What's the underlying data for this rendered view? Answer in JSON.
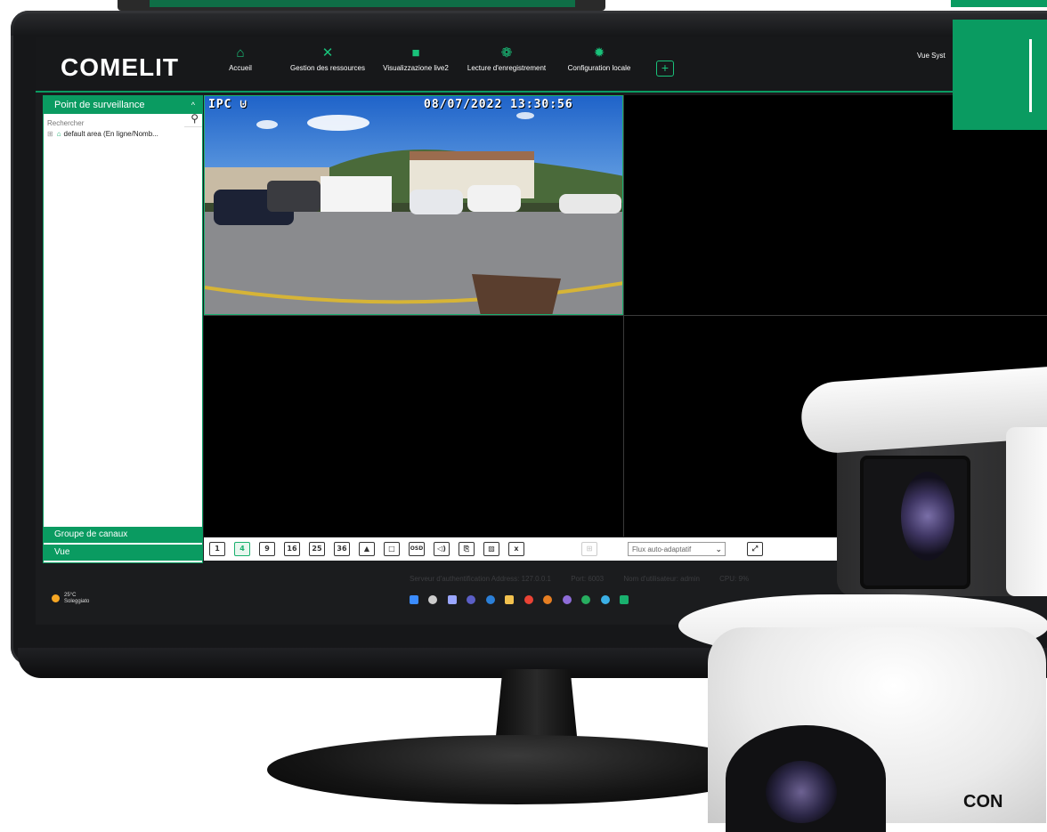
{
  "brand": {
    "logo_text": "COMELIT",
    "accent_color": "#0a9b61"
  },
  "nav": {
    "items": [
      {
        "label": "Accueil",
        "icon": "home-icon"
      },
      {
        "label": "Gestion des ressources",
        "icon": "tools-icon"
      },
      {
        "label": "Visualizzazione live2",
        "icon": "video-camera-icon"
      },
      {
        "label": "Lecture d'enregistrement",
        "icon": "playback-icon"
      },
      {
        "label": "Configuration locale",
        "icon": "gear-icon"
      }
    ],
    "add_icon": "plus-square-icon",
    "right_label": "Vue Syst"
  },
  "left_panel": {
    "header": "Point de surveillance",
    "search_placeholder": "Rechercher",
    "tree_item": "default area (En ligne/Nomb...",
    "group_channels": "Groupe de canaux",
    "view": "Vue"
  },
  "video": {
    "channel_label": "IPC",
    "channel_icon": "signal-icon",
    "timestamp": "08/07/2022 13:30:56"
  },
  "toolbar": {
    "buttons": [
      {
        "label": "1",
        "name": "layout-1-button"
      },
      {
        "label": "4",
        "name": "layout-4-button",
        "active": true
      },
      {
        "label": "9",
        "name": "layout-9-button"
      },
      {
        "label": "16",
        "name": "layout-16-button"
      },
      {
        "label": "25",
        "name": "layout-25-button"
      },
      {
        "label": "36",
        "name": "layout-36-button"
      },
      {
        "label": "▲",
        "name": "custom-layout-button"
      },
      {
        "label": "□",
        "name": "full-screen-button"
      },
      {
        "label": "OSD",
        "name": "osd-toggle-button"
      },
      {
        "label": "◁)",
        "name": "audio-button"
      },
      {
        "label": "⎘",
        "name": "snapshot-button"
      },
      {
        "label": "▨",
        "name": "close-all-button"
      },
      {
        "label": "x",
        "name": "stop-all-button"
      },
      {
        "label": "⊞",
        "name": "grid-button"
      }
    ],
    "stream_select": "Flux auto-adaptatif",
    "maximize_icon": "expand-icon"
  },
  "status_bar": {
    "server": "Serveur d'authentification Address: 127.0.0.1",
    "port": "Port: 6003",
    "user": "Nom d'utilisateur: admin",
    "cpu": "CPU: 9%"
  },
  "taskbar": {
    "weather_temp": "25°C",
    "weather_desc": "Soleggiato"
  },
  "camera_logo": "CON"
}
